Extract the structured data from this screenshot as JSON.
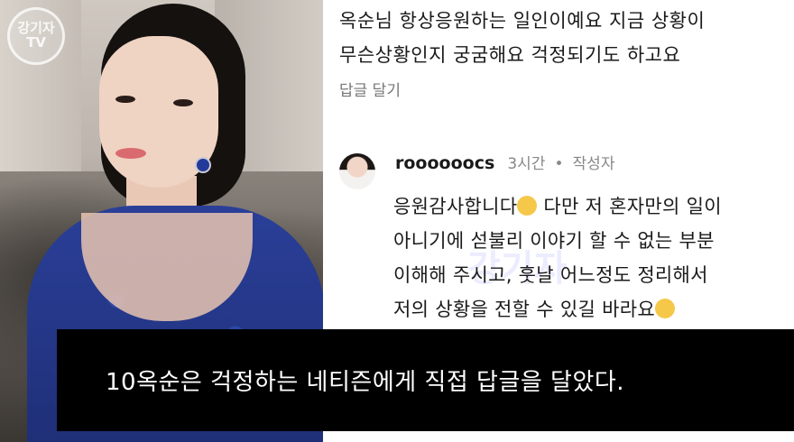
{
  "watermark": {
    "top": "강기자",
    "bottom": "TV"
  },
  "comment_main": {
    "line1": "옥순님  항상응원하는  일인이예요  지금 상황이",
    "line2": "무슨상황인지  궁굼해요  걱정되기도  하고요",
    "reply_label": "답글 달기"
  },
  "comment_reply": {
    "username": "roooooocs",
    "time": "3시간",
    "separator": "•",
    "author_tag": "작성자",
    "line1_before_emoji": "응원감사합니다",
    "line1_after_emoji": " 다만 저 혼자만의 일이",
    "line2": "아니기에 섣불리 이야기 할 수 없는 부분",
    "line3": "이해해 주시고, 훗날 어느정도 정리해서",
    "line4_before_emoji": "저의 상황을 전할 수 있길 바라요",
    "emoji1": "pleading-face-emoji",
    "emoji2": "smiling-face-emoji"
  },
  "caption": "10옥순은 걱정하는 네티즌에게 직접 답글을 달았다.",
  "colors": {
    "caption_bg": "#000000",
    "caption_text": "#ffffff",
    "comment_text": "#1a1a1a",
    "meta_text": "#888888",
    "dress": "#2a3f98"
  }
}
